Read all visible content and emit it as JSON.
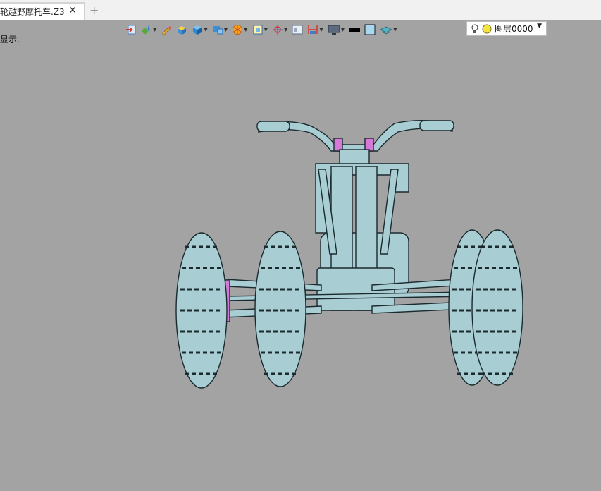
{
  "tabs": [
    {
      "title": "轮越野摩托车.Z3",
      "active": true
    }
  ],
  "tab_close_glyph": "✕",
  "tab_add_glyph": "+",
  "status_hint": "显示.",
  "toolbar": {
    "icons": [
      "import-icon",
      "paint-drop-icon",
      "pencil-icon",
      "box-shaded-icon",
      "cube-shaded-icon",
      "cube-views-icon",
      "render-sphere-icon",
      "frame-icon",
      "origin-icon",
      "window-icon",
      "dimension-icon",
      "display-icon",
      "line-color-swatch",
      "fill-color-swatch",
      "layer-stack-icon"
    ],
    "colors": {
      "line_swatch": "#000000",
      "fill_swatch": "#a9d7ee",
      "model": "#a8cdd3"
    },
    "layer": {
      "value": "图层0000",
      "bulb_icon": "light-bulb-icon",
      "status_color": "#f3e642"
    }
  }
}
